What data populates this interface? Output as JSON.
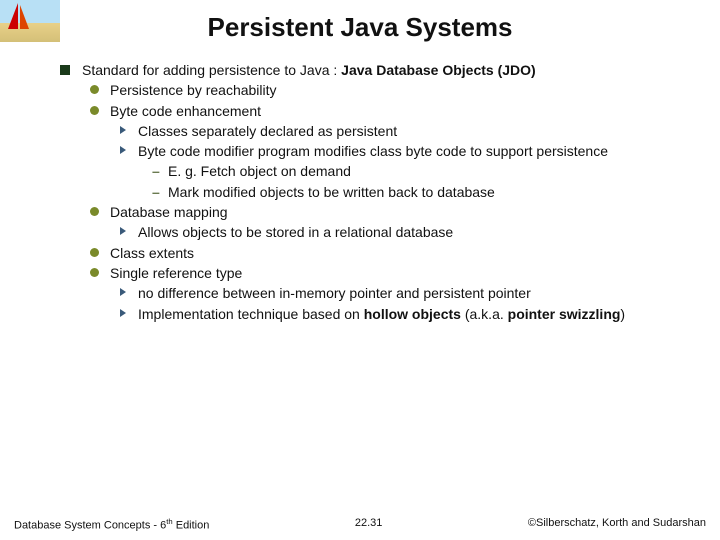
{
  "title": "Persistent Java Systems",
  "content": {
    "l1_main": "Standard for adding persistence to Java : ",
    "l1_bold": "Java Database Objects (JDO)",
    "l2_1": "Persistence by reachability",
    "l2_2": "Byte code enhancement",
    "l3_1": "Classes separately declared as persistent",
    "l3_2": "Byte code modifier program modifies class byte code to support persistence",
    "l4_1": "E. g. Fetch object on demand",
    "l4_2": "Mark modified objects to be written back to database",
    "l2_3": "Database mapping",
    "l3_3": "Allows objects to be stored in a relational database",
    "l2_4": "Class extents",
    "l2_5": "Single reference type",
    "l3_4": "no difference between in-memory pointer and persistent pointer",
    "l3_5a": "Implementation technique based on ",
    "l3_5b": "hollow objects",
    "l3_5c": " (a.k.a. ",
    "l3_5d": "pointer swizzling",
    "l3_5e": ")"
  },
  "footer": {
    "left_a": "Database System Concepts - 6",
    "left_b": "th",
    "left_c": " Edition",
    "center": "22.31",
    "right": "©Silberschatz, Korth and Sudarshan"
  }
}
